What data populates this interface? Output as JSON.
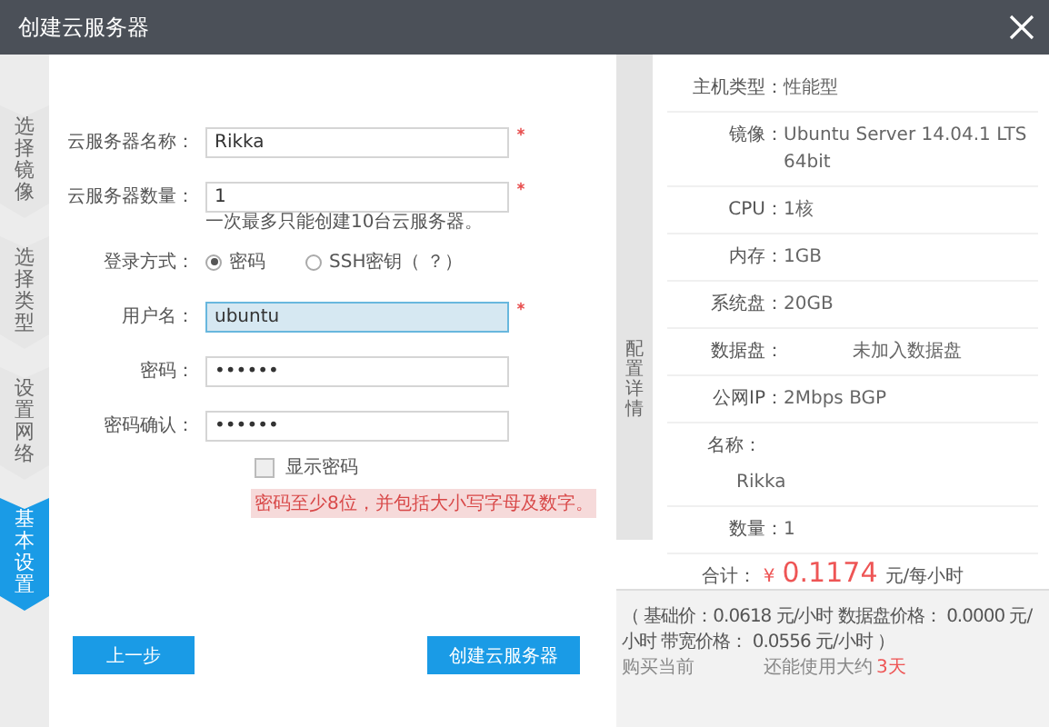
{
  "window": {
    "title": "创建云服务器"
  },
  "steps": [
    {
      "label": "选择镜像",
      "selected": false
    },
    {
      "label": "选择类型",
      "selected": false
    },
    {
      "label": "设置网络",
      "selected": false
    },
    {
      "label": "基本设置",
      "selected": true
    }
  ],
  "form": {
    "rows": [
      {
        "kind": "input",
        "label": "云服务器名称：",
        "value": "Rikka",
        "required": true,
        "focused": false
      },
      {
        "kind": "input",
        "label": "云服务器数量：",
        "value": "1",
        "required": true,
        "focused": false
      },
      {
        "kind": "note",
        "text": "一次最多只能创建10台云服务器。"
      },
      {
        "kind": "radio",
        "label": "登录方式：",
        "options": [
          {
            "label": "密码",
            "selected": true
          },
          {
            "label": "SSH密钥（ ？）",
            "selected": false
          }
        ]
      },
      {
        "kind": "input",
        "label": "用户名：",
        "value": "ubuntu",
        "required": true,
        "focused": true
      },
      {
        "kind": "input",
        "label": "密码：",
        "value": "••••••",
        "focused": false
      },
      {
        "kind": "input",
        "label": "密码确认：",
        "value": "••••••",
        "focused": false
      },
      {
        "kind": "checkbox",
        "label": "显示密码",
        "checked": false
      },
      {
        "kind": "error",
        "text": "密码至少8位，并包括大小写字母及数字。"
      }
    ]
  },
  "buttons": [
    {
      "label": "上一步"
    },
    {
      "label": "创建云服务器"
    }
  ],
  "details": {
    "tab": "配置详情",
    "rows": [
      {
        "kind": "inline",
        "label": "主机类型：",
        "value": "性能型"
      },
      {
        "kind": "inline",
        "label": "镜像：",
        "value": "Ubuntu Server 14.04.1 LTS 64bit"
      },
      {
        "kind": "inline",
        "label": "CPU：",
        "value": "1核"
      },
      {
        "kind": "inline",
        "label": "内存：",
        "value": "1GB"
      },
      {
        "kind": "inline",
        "label": "系统盘：",
        "value": "20GB"
      },
      {
        "kind": "wide",
        "label": "数据盘：",
        "value": "未加入数据盘"
      },
      {
        "kind": "inline",
        "label": "公网IP：",
        "value": "2Mbps BGP"
      },
      {
        "kind": "stacked",
        "label": "名称：",
        "value": "Rikka"
      },
      {
        "kind": "inline",
        "label": "数量：",
        "value": "1"
      }
    ],
    "total": {
      "label": "合计：",
      "currency": "¥",
      "amount": "0.1174",
      "unit": "元/每小时"
    },
    "breakdown": [
      "（ 基础价：0.0618 元/小时  数据盘价格： 0.0000 元/",
      "小时  带宽价格： 0.0556 元/小时 ）"
    ],
    "remaining": [
      "购买当前",
      "还能使用大约"
    ],
    "days": "3天"
  }
}
